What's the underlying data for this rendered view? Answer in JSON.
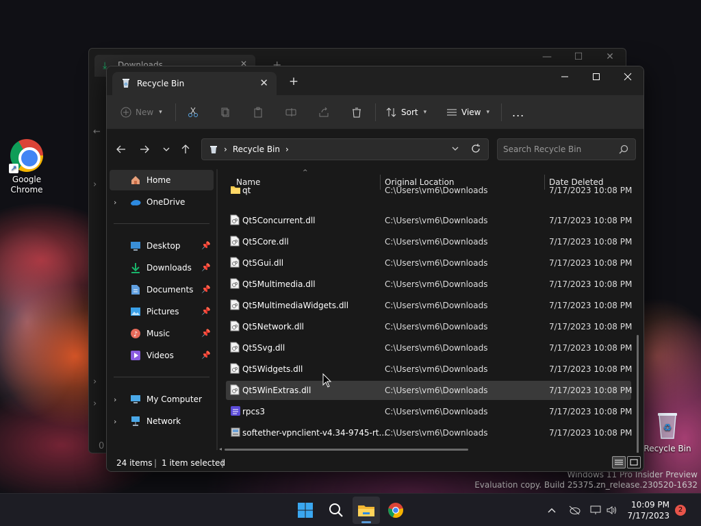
{
  "desktop": {
    "icons": [
      {
        "label_line1": "Google",
        "label_line2": "Chrome",
        "icon": "chrome-icon"
      },
      {
        "label": "Recycle Bin",
        "icon": "recycle-bin-icon"
      }
    ],
    "watermark_line1": "Windows 11 Pro Insider Preview",
    "watermark_line2": "Evaluation copy. Build 25375.zn_release.230520-1632"
  },
  "back_window": {
    "tab_title": "Downloads",
    "status_fragment": "0 i"
  },
  "window": {
    "tab_title": "Recycle Bin",
    "toolbar": {
      "new_label": "New",
      "sort_label": "Sort",
      "view_label": "View",
      "more_label": "..."
    },
    "address": {
      "location": "Recycle Bin"
    },
    "search": {
      "placeholder": "Search Recycle Bin"
    },
    "nav": {
      "home": "Home",
      "onedrive": "OneDrive",
      "desktop": "Desktop",
      "downloads": "Downloads",
      "documents": "Documents",
      "pictures": "Pictures",
      "music": "Music",
      "videos": "Videos",
      "my_computer": "My Computer",
      "network": "Network"
    },
    "columns": {
      "name": "Name",
      "original_location": "Original Location",
      "date_deleted": "Date Deleted"
    },
    "rows": [
      {
        "name": "qt",
        "location": "C:\\Users\\vm6\\Downloads",
        "date": "7/17/2023 10:08 PM",
        "icon": "folder-icon"
      },
      {
        "name": "Qt5Concurrent.dll",
        "location": "C:\\Users\\vm6\\Downloads",
        "date": "7/17/2023 10:08 PM",
        "icon": "dll-file-icon"
      },
      {
        "name": "Qt5Core.dll",
        "location": "C:\\Users\\vm6\\Downloads",
        "date": "7/17/2023 10:08 PM",
        "icon": "dll-file-icon"
      },
      {
        "name": "Qt5Gui.dll",
        "location": "C:\\Users\\vm6\\Downloads",
        "date": "7/17/2023 10:08 PM",
        "icon": "dll-file-icon"
      },
      {
        "name": "Qt5Multimedia.dll",
        "location": "C:\\Users\\vm6\\Downloads",
        "date": "7/17/2023 10:08 PM",
        "icon": "dll-file-icon"
      },
      {
        "name": "Qt5MultimediaWidgets.dll",
        "location": "C:\\Users\\vm6\\Downloads",
        "date": "7/17/2023 10:08 PM",
        "icon": "dll-file-icon"
      },
      {
        "name": "Qt5Network.dll",
        "location": "C:\\Users\\vm6\\Downloads",
        "date": "7/17/2023 10:08 PM",
        "icon": "dll-file-icon"
      },
      {
        "name": "Qt5Svg.dll",
        "location": "C:\\Users\\vm6\\Downloads",
        "date": "7/17/2023 10:08 PM",
        "icon": "dll-file-icon"
      },
      {
        "name": "Qt5Widgets.dll",
        "location": "C:\\Users\\vm6\\Downloads",
        "date": "7/17/2023 10:08 PM",
        "icon": "dll-file-icon"
      },
      {
        "name": "Qt5WinExtras.dll",
        "location": "C:\\Users\\vm6\\Downloads",
        "date": "7/17/2023 10:08 PM",
        "icon": "dll-file-icon",
        "selected": true
      },
      {
        "name": "rpcs3",
        "location": "C:\\Users\\vm6\\Downloads",
        "date": "7/17/2023 10:08 PM",
        "icon": "rpcs3-app-icon"
      },
      {
        "name": "softether-vpnclient-v4.34-9745-rt...",
        "location": "C:\\Users\\vm6\\Downloads",
        "date": "7/17/2023 10:08 PM",
        "icon": "installer-icon"
      }
    ],
    "status": {
      "item_count": "24 items",
      "separator": "|",
      "selection": "1 item selected"
    }
  },
  "taskbar": {
    "time": "10:09 PM",
    "date": "7/17/2023",
    "notification_count": "2",
    "apps": [
      "start-button",
      "search-button",
      "file-explorer-app",
      "chrome-app"
    ]
  },
  "colors": {
    "window_bg": "#191919",
    "toolbar_bg": "#2c2c2c",
    "selection_bg": "#3a3a3a",
    "downloads_green": "#19b46a",
    "folder_yellow": "#f2c94c",
    "notification_red": "#e8544a"
  }
}
